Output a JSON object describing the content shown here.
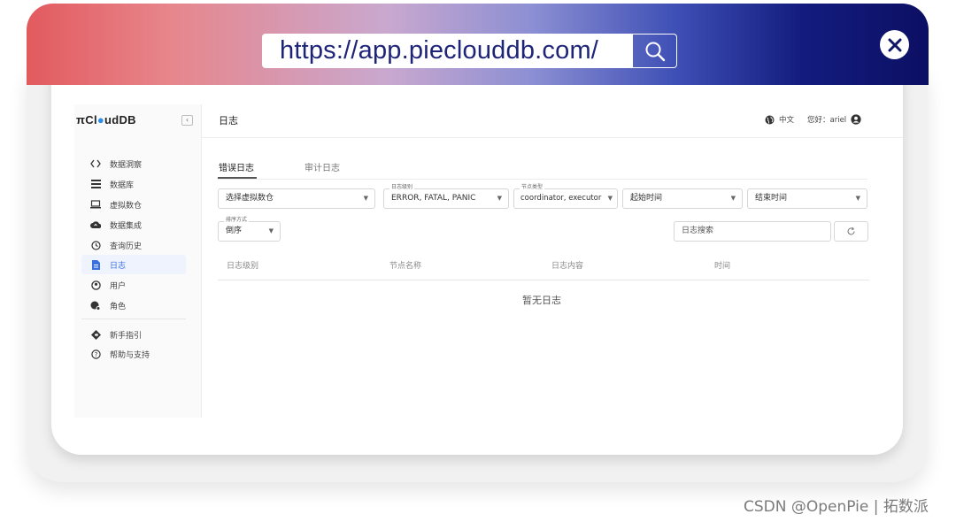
{
  "browser": {
    "url": "https://app.pieclouddb.com/",
    "search_icon": "search-icon",
    "close_icon": "close-icon"
  },
  "sidebar": {
    "logo": "πCl●udDB",
    "collapse_icon": "chevron-left-icon",
    "items": [
      {
        "label": "数据洞察",
        "icon": "code-icon"
      },
      {
        "label": "数据库",
        "icon": "list-icon"
      },
      {
        "label": "虚拟数仓",
        "icon": "laptop-icon"
      },
      {
        "label": "数据集成",
        "icon": "cloud-upload-icon"
      },
      {
        "label": "查询历史",
        "icon": "history-icon"
      },
      {
        "label": "日志",
        "icon": "file-icon",
        "active": true
      },
      {
        "label": "用户",
        "icon": "user-icon"
      },
      {
        "label": "角色",
        "icon": "role-icon"
      }
    ],
    "footer_items": [
      {
        "label": "新手指引",
        "icon": "guide-icon"
      },
      {
        "label": "帮助与支持",
        "icon": "help-icon"
      }
    ]
  },
  "header": {
    "title": "日志",
    "lang": "中文",
    "greeting": "您好：ariel",
    "lang_icon": "globe-icon",
    "avatar_icon": "user-avatar-icon"
  },
  "tabs": [
    {
      "label": "错误日志",
      "active": true
    },
    {
      "label": "审计日志",
      "active": false
    }
  ],
  "filters": {
    "warehouse": {
      "value": "选择虚拟数仓"
    },
    "level": {
      "label": "日志级别",
      "value": "ERROR, FATAL, PANIC"
    },
    "node_type": {
      "label": "节点类型",
      "value": "coordinator, executor"
    },
    "start_time": {
      "value": "起始时间"
    },
    "end_time": {
      "value": "结束时间"
    },
    "sort": {
      "label": "排序方式",
      "value": "倒序"
    },
    "search_placeholder": "日志搜索"
  },
  "table": {
    "columns": [
      "日志级别",
      "节点名称",
      "日志内容",
      "时间"
    ],
    "empty_text": "暂无日志"
  },
  "watermark": "CSDN @OpenPie | 拓数派",
  "colors": {
    "accent": "#3a6fe0",
    "bar_start": "#e25a5e",
    "bar_end": "#0c0f63"
  }
}
